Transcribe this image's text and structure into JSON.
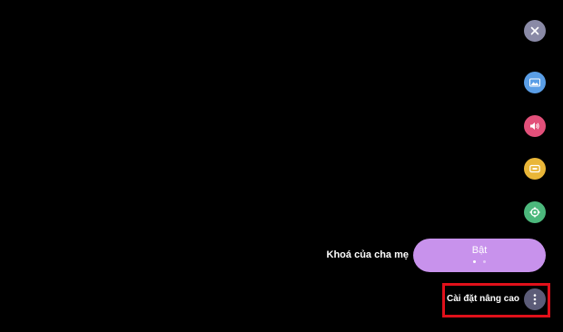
{
  "settings_panel": {
    "close": {
      "icon": "close-icon",
      "color": "#8a8aa6"
    },
    "categories": [
      {
        "id": "picture",
        "icon": "picture-icon",
        "color": "#5a9ee6"
      },
      {
        "id": "sound",
        "icon": "speaker-icon",
        "color": "#e2507a"
      },
      {
        "id": "channels",
        "icon": "channels-icon",
        "color": "#e9b638"
      },
      {
        "id": "general",
        "icon": "general-settings-icon",
        "color": "#4cb87c"
      }
    ],
    "parental_lock": {
      "label": "Khoá của cha mẹ",
      "value": "Bật",
      "pill_color": "#c892ec",
      "page_count": 2,
      "current_page": 1
    },
    "advanced": {
      "label": "Cài đặt nâng cao",
      "icon": "more-vertical-icon",
      "highlight_color": "#e0101a"
    }
  }
}
